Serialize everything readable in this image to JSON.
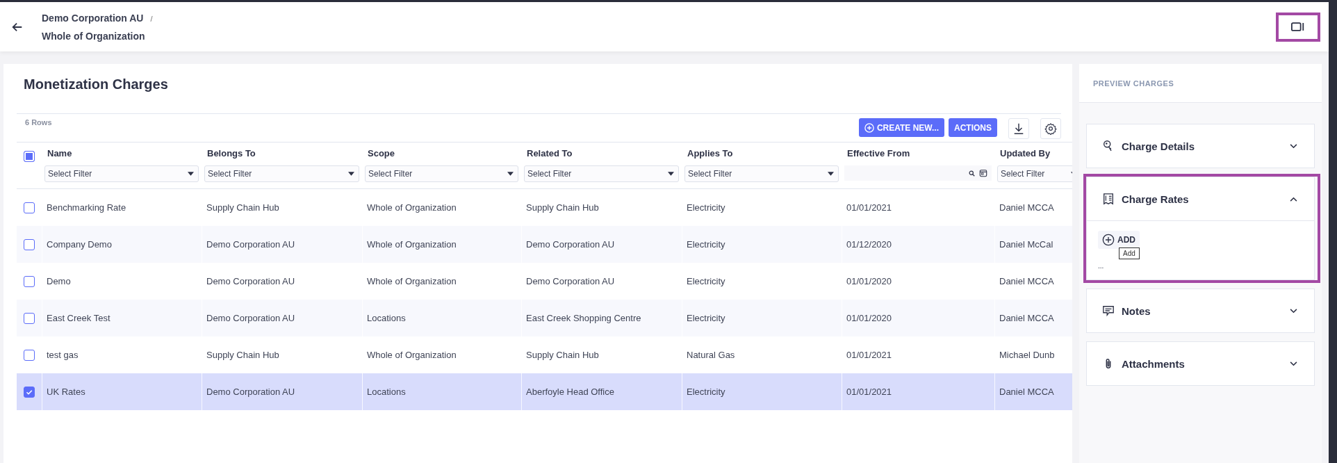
{
  "breadcrumb": {
    "parent": "Demo Corporation AU",
    "separator": "/",
    "current": "Whole of Organization"
  },
  "main": {
    "title": "Monetization Charges",
    "row_count": "6 Rows",
    "toolbar": {
      "create_button": "CREATE NEW...",
      "actions_button": "ACTIONS"
    },
    "table": {
      "select_all": {
        "indeterminate": true
      },
      "columns": [
        {
          "label": "Name",
          "filter": "Select Filter",
          "kind": "select"
        },
        {
          "label": "Belongs To",
          "filter": "Select Filter",
          "kind": "select"
        },
        {
          "label": "Scope",
          "filter": "Select Filter",
          "kind": "select"
        },
        {
          "label": "Related To",
          "filter": "Select Filter",
          "kind": "select"
        },
        {
          "label": "Applies To",
          "filter": "Select Filter",
          "kind": "select"
        },
        {
          "label": "Effective From",
          "kind": "date"
        },
        {
          "label": "Updated By",
          "filter": "Select Filter",
          "kind": "select"
        }
      ],
      "rows": [
        {
          "selected": false,
          "cells": [
            "Benchmarking Rate",
            "Supply Chain Hub",
            "Whole of Organization",
            "Supply Chain Hub",
            "Electricity",
            "01/01/2021",
            "Daniel MCCA"
          ]
        },
        {
          "selected": false,
          "cells": [
            "Company Demo",
            "Demo Corporation AU",
            "Whole of Organization",
            "Demo Corporation AU",
            "Electricity",
            "01/12/2020",
            "Daniel McCal"
          ]
        },
        {
          "selected": false,
          "cells": [
            "Demo",
            "Demo Corporation AU",
            "Whole of Organization",
            "Demo Corporation AU",
            "Electricity",
            "01/01/2020",
            "Daniel MCCA"
          ]
        },
        {
          "selected": false,
          "cells": [
            "East Creek Test",
            "Demo Corporation AU",
            "Locations",
            "East Creek Shopping Centre",
            "Electricity",
            "01/01/2020",
            "Daniel MCCA"
          ]
        },
        {
          "selected": false,
          "cells": [
            "test gas",
            "Supply Chain Hub",
            "Whole of Organization",
            "Supply Chain Hub",
            "Natural Gas",
            "01/01/2021",
            "Michael Dunb"
          ]
        },
        {
          "selected": true,
          "cells": [
            "UK Rates",
            "Demo Corporation AU",
            "Locations",
            "Aberfoyle Head Office",
            "Electricity",
            "01/01/2021",
            "Daniel MCCA"
          ]
        }
      ]
    }
  },
  "preview": {
    "title": "PREVIEW CHARGES",
    "sections": [
      {
        "title": "Charge Details",
        "expanded": false
      },
      {
        "title": "Charge Rates",
        "expanded": true,
        "add_button": "ADD",
        "tooltip": "Add",
        "ellipsis": "..."
      },
      {
        "title": "Notes",
        "expanded": false
      },
      {
        "title": "Attachments",
        "expanded": false
      }
    ]
  }
}
